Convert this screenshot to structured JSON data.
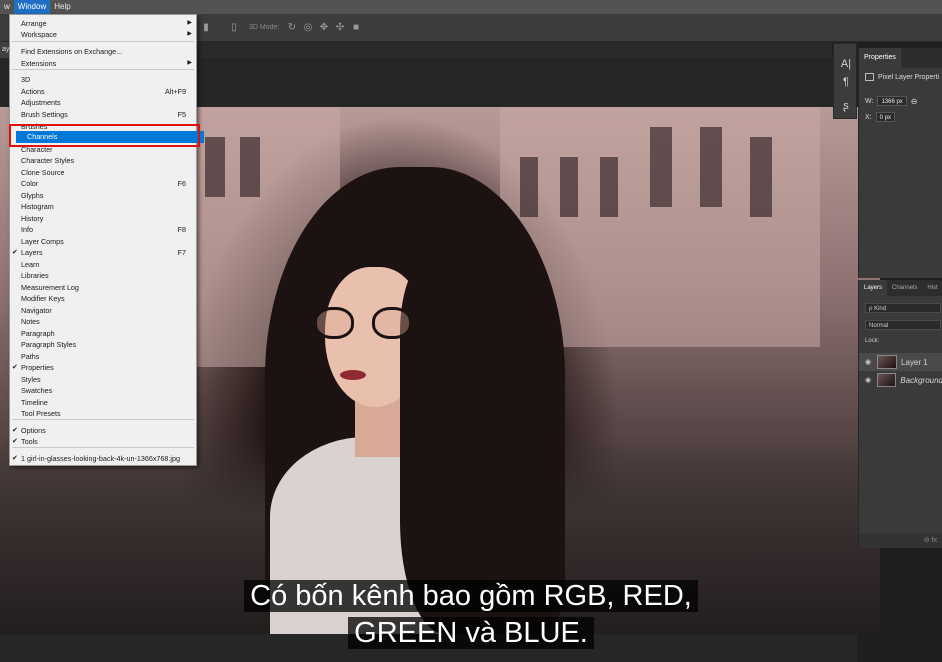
{
  "menubar": {
    "items": [
      "w",
      "Window",
      "Help"
    ]
  },
  "options_bar": {
    "mode_label": "3D Mode:"
  },
  "tabstrip": {
    "tab_label": "aye"
  },
  "window_menu": {
    "items": [
      {
        "label": "Arrange",
        "submenu": true
      },
      {
        "label": "Workspace",
        "submenu": true
      },
      {
        "label": "Find Extensions on Exchange..."
      },
      {
        "label": "Extensions",
        "submenu": true
      },
      {
        "label": "3D"
      },
      {
        "label": "Actions",
        "shortcut": "Alt+F9"
      },
      {
        "label": "Adjustments"
      },
      {
        "label": "Brush Settings",
        "shortcut": "F5"
      },
      {
        "label": "Brushes"
      },
      {
        "label": "Channels",
        "highlighted": true
      },
      {
        "label": "Character"
      },
      {
        "label": "Character Styles"
      },
      {
        "label": "Clone Source"
      },
      {
        "label": "Color",
        "shortcut": "F6"
      },
      {
        "label": "Glyphs"
      },
      {
        "label": "Histogram"
      },
      {
        "label": "History"
      },
      {
        "label": "Info",
        "shortcut": "F8"
      },
      {
        "label": "Layer Comps"
      },
      {
        "label": "Layers",
        "shortcut": "F7",
        "checked": true
      },
      {
        "label": "Learn"
      },
      {
        "label": "Libraries"
      },
      {
        "label": "Measurement Log"
      },
      {
        "label": "Modifier Keys"
      },
      {
        "label": "Navigator"
      },
      {
        "label": "Notes"
      },
      {
        "label": "Paragraph"
      },
      {
        "label": "Paragraph Styles"
      },
      {
        "label": "Paths"
      },
      {
        "label": "Properties",
        "checked": true
      },
      {
        "label": "Styles"
      },
      {
        "label": "Swatches"
      },
      {
        "label": "Timeline"
      },
      {
        "label": "Tool Presets"
      },
      {
        "label": "Options",
        "checked": true
      },
      {
        "label": "Tools",
        "checked": true
      },
      {
        "label": "1 girl-in-glasses-looking-back-4k-un-1366x768.jpg",
        "checked": true
      }
    ],
    "check_glyph": "✔",
    "submenu_glyph": "▶"
  },
  "properties": {
    "tab": "Properties",
    "subtitle": "Pixel Layer Properti",
    "w_label": "W:",
    "w_value": "1366 px",
    "x_label": "X:",
    "x_value": "0 px"
  },
  "layers_panel": {
    "tabs": [
      "Layers",
      "Channels",
      "Hist"
    ],
    "filter": "ρ Kind",
    "blend_mode": "Normal",
    "lock_label": "Lock:",
    "layers": [
      {
        "name": "Layer 1",
        "selected": true
      },
      {
        "name": "Background",
        "selected": false
      }
    ],
    "footer": "⊖  fx"
  },
  "captions": {
    "line1": "Có bốn kênh bao gồm RGB, RED,",
    "line2": "GREEN và BLUE."
  },
  "colors": {
    "highlight": "#0078d7",
    "annotation_box": "#e01010"
  }
}
